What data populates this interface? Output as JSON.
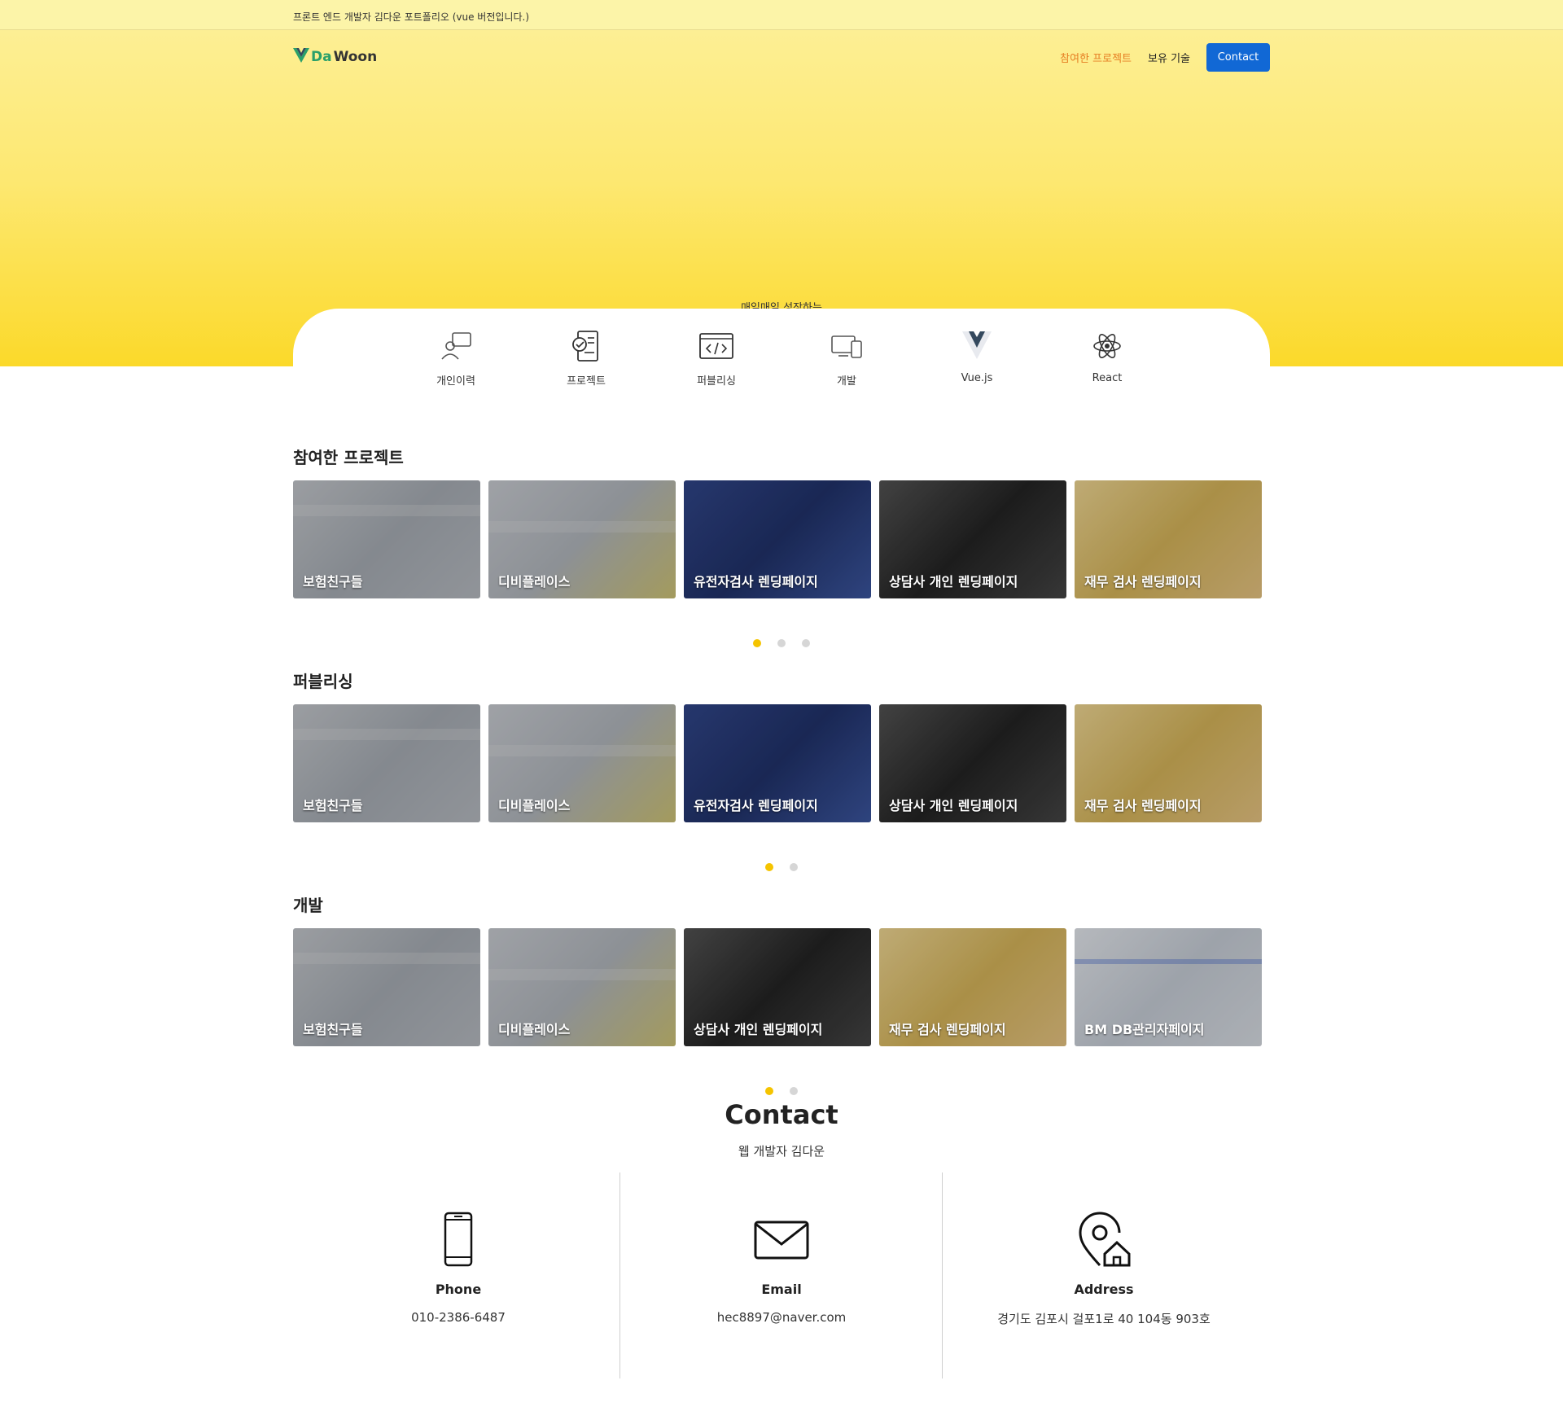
{
  "topbar": {
    "text": "프론트 엔드 개발자 김다운 포트폴리오 (vue 버전입니다.)"
  },
  "logo": {
    "part1": "Da",
    "part2": "Woon"
  },
  "nav": {
    "projects": "참여한 프로젝트",
    "skills": "보유 기술",
    "contact": "Contact"
  },
  "hero": {
    "slogan": "매일매일 성장하는"
  },
  "categories": [
    "개인이력",
    "프로젝트",
    "퍼블리싱",
    "개발",
    "Vue.js",
    "React"
  ],
  "sections": [
    {
      "title": "참여한 프로젝트",
      "cards": [
        "보험친구들",
        "디비플레이스",
        "유전자검사 렌딩페이지",
        "상담사 개인 렌딩페이지",
        "재무 검사 렌딩페이지"
      ],
      "dots": 3,
      "active": 0
    },
    {
      "title": "퍼블리싱",
      "cards": [
        "보험친구들",
        "디비플레이스",
        "유전자검사 렌딩페이지",
        "상담사 개인 렌딩페이지",
        "재무 검사 렌딩페이지"
      ],
      "dots": 2,
      "active": 0
    },
    {
      "title": "개발",
      "cards": [
        "보험친구들",
        "디비플레이스",
        "상담사 개인 렌딩페이지",
        "재무 검사 렌딩페이지",
        "BM DB관리자페이지"
      ],
      "dots": 2,
      "active": 0
    }
  ],
  "contact": {
    "title": "Contact",
    "subtitle": "웹 개발자 김다운",
    "items": [
      {
        "label": "Phone",
        "value": "010-2386-6487",
        "icon": "phone-icon"
      },
      {
        "label": "Email",
        "value": "hec8897@naver.com",
        "icon": "mail-icon"
      },
      {
        "label": "Address",
        "value": "경기도 김포시 걸포1로 40 104동 903호",
        "icon": "location-home-icon"
      }
    ]
  },
  "colors": {
    "accent": "#1168d5",
    "highlight": "#e67e22",
    "dot_active": "#f5c400",
    "hero_top": "#fdef94",
    "hero_bottom": "#fbd92a"
  }
}
